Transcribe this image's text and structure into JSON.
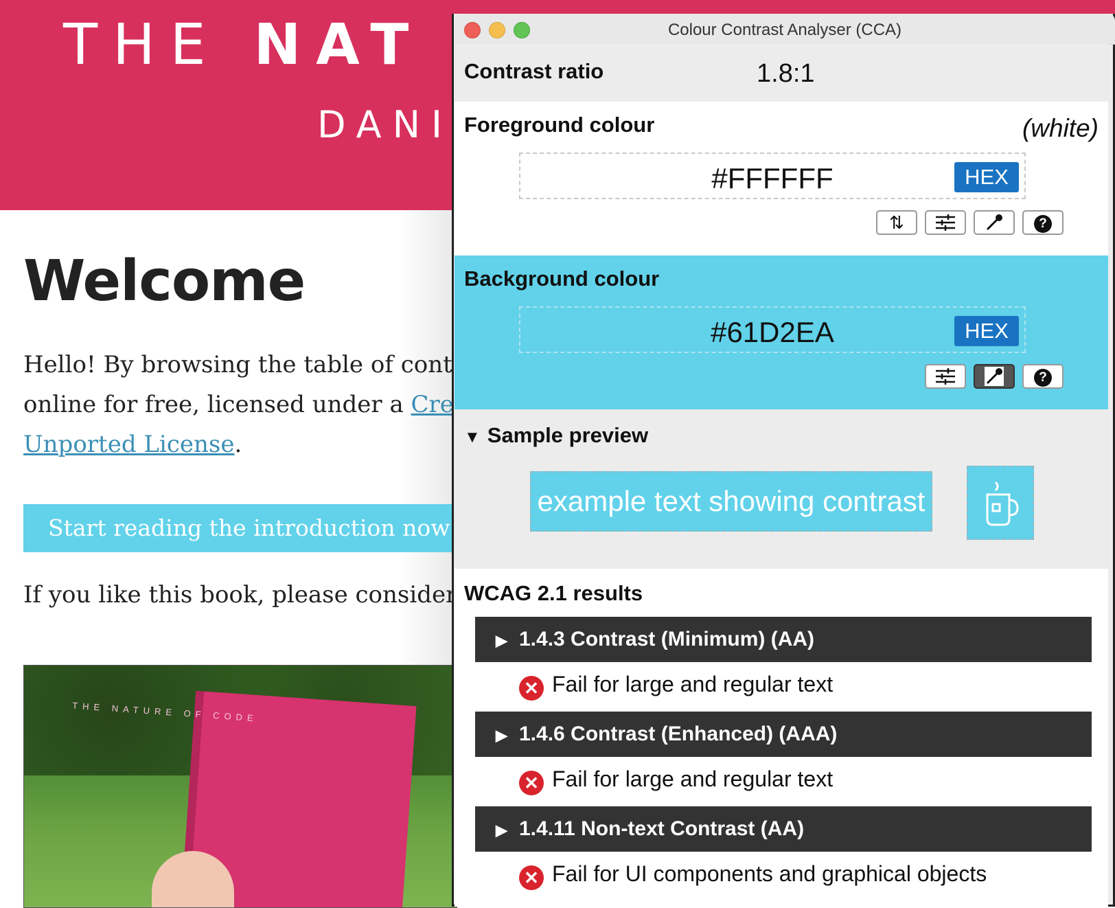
{
  "website": {
    "title_light": "THE",
    "title_bold": "NAT",
    "author": "DANI",
    "heading": "Welcome",
    "intro_line1": "Hello! By browsing the table of conte",
    "intro_line2_prefix": "online for free, licensed under a ",
    "intro_link1": "Cre",
    "intro_link2": "Unported License",
    "intro_period": ".",
    "cta_label": "Start reading the introduction now!",
    "support_text": "If you like this book, please consider",
    "book_cover_title": "THE NATURE OF CODE",
    "colors": {
      "header": "#d8305d",
      "cta": "#61d2ea",
      "link": "#3b8fb5"
    }
  },
  "cca": {
    "window_title": "Colour Contrast Analyser (CCA)",
    "contrast": {
      "label": "Contrast ratio",
      "value": "1.8:1"
    },
    "foreground": {
      "label": "Foreground colour",
      "name": "(white)",
      "hex": "#FFFFFF",
      "format": "HEX",
      "tools": [
        "swap-icon",
        "sliders-icon",
        "eyedropper-icon",
        "help-icon"
      ]
    },
    "background": {
      "label": "Background colour",
      "hex": "#61D2EA",
      "format": "HEX",
      "tools": [
        "sliders-icon",
        "eyedropper-icon",
        "help-icon"
      ]
    },
    "preview": {
      "label": "Sample preview",
      "sample_text": "example text showing contrast",
      "icon": "mug-icon"
    },
    "results": {
      "label": "WCAG 2.1 results",
      "criteria": [
        {
          "title": "1.4.3 Contrast (Minimum) (AA)",
          "result": "Fail for large and regular text"
        },
        {
          "title": "1.4.6 Contrast (Enhanced) (AAA)",
          "result": "Fail for large and regular text"
        },
        {
          "title": "1.4.11 Non-text Contrast (AA)",
          "result": "Fail for UI components and graphical objects"
        }
      ]
    },
    "colors": {
      "hex_badge": "#1a73c2",
      "fail": "#d9232d",
      "criterion_bg": "#333333"
    }
  }
}
